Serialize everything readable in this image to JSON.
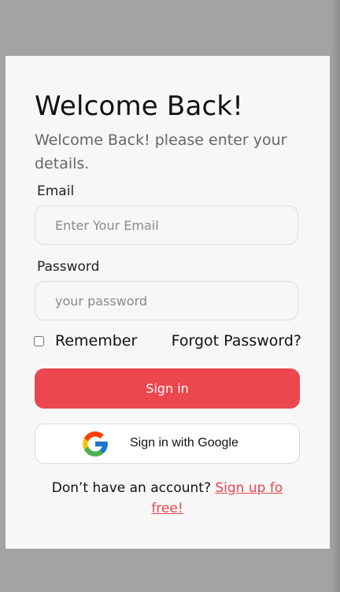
{
  "colors": {
    "backdrop": "#a3a3a3",
    "card": "#f7f7f7",
    "accent": "#ec464f"
  },
  "login": {
    "title": "Welcome Back!",
    "subtitle": "Welcome Back! please enter your details.",
    "email_label": "Email",
    "email_placeholder": "Enter Your Email",
    "email_value": "",
    "password_label": "Password",
    "password_placeholder": "your password",
    "password_value": "",
    "remember_label": "Remember",
    "remember_checked": false,
    "forgot_label": "Forgot Password?",
    "signin_label": "Sign in",
    "google_icon": "google-icon",
    "google_label": "Sign in with Google",
    "signup_prompt": "Don’t have an account?",
    "signup_link": "Sign up fo free!"
  }
}
